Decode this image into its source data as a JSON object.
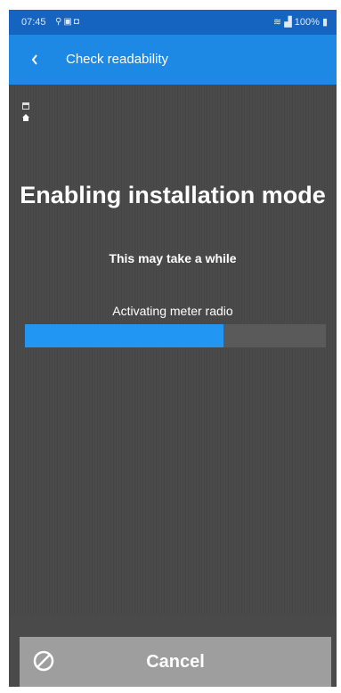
{
  "status_bar": {
    "time": "07:45",
    "right_text": "100%",
    "icons": [
      "wind-icon",
      "image-icon",
      "square-icon",
      "wifi-icon",
      "signal-icon",
      "battery-icon"
    ]
  },
  "app_bar": {
    "title": "Check readability",
    "back_icon": "chevron-left-icon"
  },
  "main": {
    "heading": "Enabling installation mode",
    "subtitle": "This may take a while",
    "status": "Activating meter radio",
    "progress": 0.66,
    "side_icons": [
      "calendar-icon",
      "home-icon"
    ]
  },
  "footer": {
    "cancel_label": "Cancel",
    "cancel_icon": "no-entry-icon"
  },
  "colors": {
    "status_bar": "#1565c0",
    "app_bar": "#1e88e5",
    "background": "#4a4a4a",
    "progress_fill": "#2196f3",
    "button": "#9e9e9e"
  }
}
